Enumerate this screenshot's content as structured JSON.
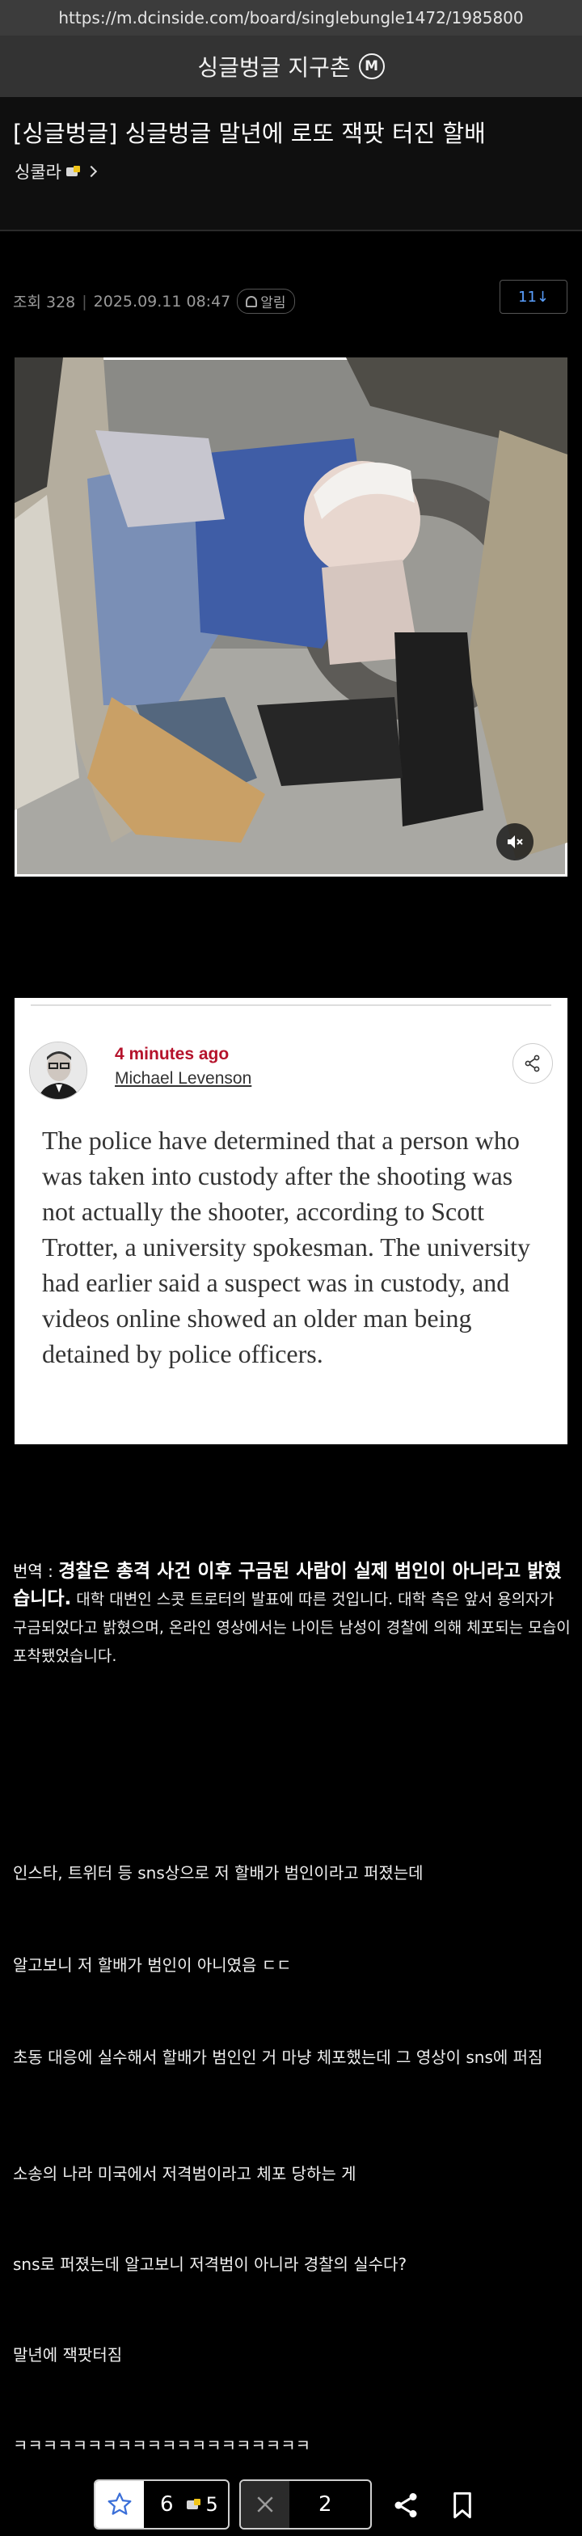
{
  "browser": {
    "url": "https://m.dcinside.com/board/singlebungle1472/1985800"
  },
  "gallery": {
    "name": "싱글벙글 지구촌",
    "badge": "M"
  },
  "post": {
    "title": "[싱글벙글] 싱글벙글 말년에 로또 잭팟 터진 할배",
    "author": "싱쿨라",
    "views": "조회 328",
    "date": "2025.09.11 08:47",
    "notify_label": "알림",
    "comment_button": "11↓"
  },
  "article_card": {
    "time_ago": "4 minutes ago",
    "author": "Michael Levenson",
    "body": "The police have determined that a person who was taken into custody after the shooting was not actually the shooter, according to Scott Trotter, a university spokesman. The university had earlier said a suspect was in custody, and videos online showed an older man being detained by police officers."
  },
  "translation": {
    "label": "번역 : ",
    "headline": "경찰은 총격 사건 이후 구금된 사람이 실제 범인이 아니라고 밝혔습니다.",
    "detail": " 대학 대변인 스콧 트로터의 발표에 따른 것입니다. 대학 측은 앞서 용의자가 구금되었다고 밝혔으며, 온라인 영상에서는 나이든 남성이 경찰에 의해 체포되는 모습이 포착됐었습니다."
  },
  "body_lines": [
    "인스타, 트위터 등 sns상으로 저 할배가 범인이라고 퍼졌는데",
    "알고보니 저 할배가 범인이 아니였음 ㄷㄷ",
    "초동 대응에 실수해서 할배가 범인인 거 마냥 체포했는데 그 영상이 sns에 퍼짐",
    "소송의 나라 미국에서 저격범이라고 체포 당하는 게",
    "sns로 퍼졌는데 알고보니 저격범이 아니라 경찰의 실수다?",
    "말년에 잭팟터짐",
    "ㅋㅋㅋㅋㅋㅋㅋㅋㅋㅋㅋㅋㅋㅋㅋㅋㅋㅋㅋㅋ"
  ],
  "actions": {
    "recommend_count": "6",
    "fixed_recommend_count": "5",
    "nonrecommend_count": "2"
  },
  "icons": [
    "minor-gallery-badge-icon",
    "fixed-nick-icon",
    "chevron-right-icon",
    "bell-icon",
    "mute-icon",
    "share-icon",
    "star-icon",
    "x-icon",
    "bookmark-icon"
  ]
}
